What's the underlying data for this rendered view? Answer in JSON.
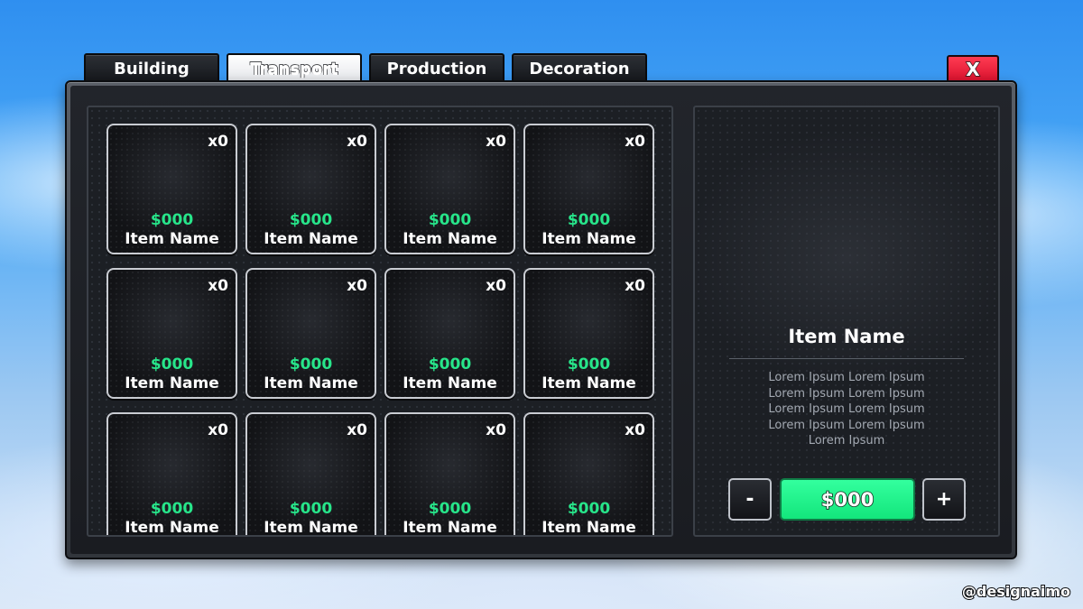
{
  "tabs": [
    {
      "label": "Building",
      "active": false
    },
    {
      "label": "Transport",
      "active": true
    },
    {
      "label": "Production",
      "active": false
    },
    {
      "label": "Decoration",
      "active": false
    }
  ],
  "close_label": "X",
  "items": [
    {
      "qty": "x0",
      "price": "$000",
      "name": "Item Name"
    },
    {
      "qty": "x0",
      "price": "$000",
      "name": "Item Name"
    },
    {
      "qty": "x0",
      "price": "$000",
      "name": "Item Name"
    },
    {
      "qty": "x0",
      "price": "$000",
      "name": "Item Name"
    },
    {
      "qty": "x0",
      "price": "$000",
      "name": "Item Name"
    },
    {
      "qty": "x0",
      "price": "$000",
      "name": "Item Name"
    },
    {
      "qty": "x0",
      "price": "$000",
      "name": "Item Name"
    },
    {
      "qty": "x0",
      "price": "$000",
      "name": "Item Name"
    },
    {
      "qty": "x0",
      "price": "$000",
      "name": "Item Name"
    },
    {
      "qty": "x0",
      "price": "$000",
      "name": "Item Name"
    },
    {
      "qty": "x0",
      "price": "$000",
      "name": "Item Name"
    },
    {
      "qty": "x0",
      "price": "$000",
      "name": "Item Name"
    }
  ],
  "detail": {
    "title": "Item Name",
    "description_lines": [
      "Lorem Ipsum Lorem Ipsum",
      "Lorem Ipsum Lorem Ipsum",
      "Lorem Ipsum Lorem Ipsum",
      "Lorem Ipsum Lorem Ipsum",
      "Lorem Ipsum"
    ],
    "minus_label": "-",
    "plus_label": "+",
    "buy_label": "$000"
  },
  "watermark": "@designaimo",
  "colors": {
    "price_green": "#27e58a",
    "buy_button": "#1ff28a",
    "close_button": "#e8203a"
  }
}
